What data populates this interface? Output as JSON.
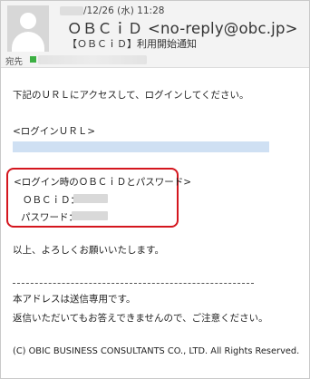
{
  "header": {
    "date_text": "/12/26 (水) 11:28",
    "sender": "ＯＢＣｉＤ <no-reply@obc.jp>",
    "subject": "【ＯＢＣｉＤ】利用開始通知",
    "to_label": "宛先"
  },
  "body": {
    "intro": "下記のＵＲＬにアクセスして、ログインしてください。",
    "url_heading": "<ログインＵＲＬ>",
    "creds_heading": "<ログイン時のＯＢＣｉＤとパスワード>",
    "obcid_label": "ＯＢＣｉＤ：",
    "password_label": "パスワード：",
    "closing": "以上、よろしくお願いいたします。",
    "divider": "--------------------------------------------------------------------------------",
    "notice1": "本アドレスは送信専用です。",
    "notice2": "返信いただいてもお答えできませんので、ご注意ください。",
    "copyright": "(C) OBIC BUSINESS CONSULTANTS CO., LTD. All Rights Reserved."
  },
  "colors": {
    "highlight_border": "#d4161e",
    "url_redacted": "#cfe0f3",
    "status_green": "#3cb043"
  }
}
